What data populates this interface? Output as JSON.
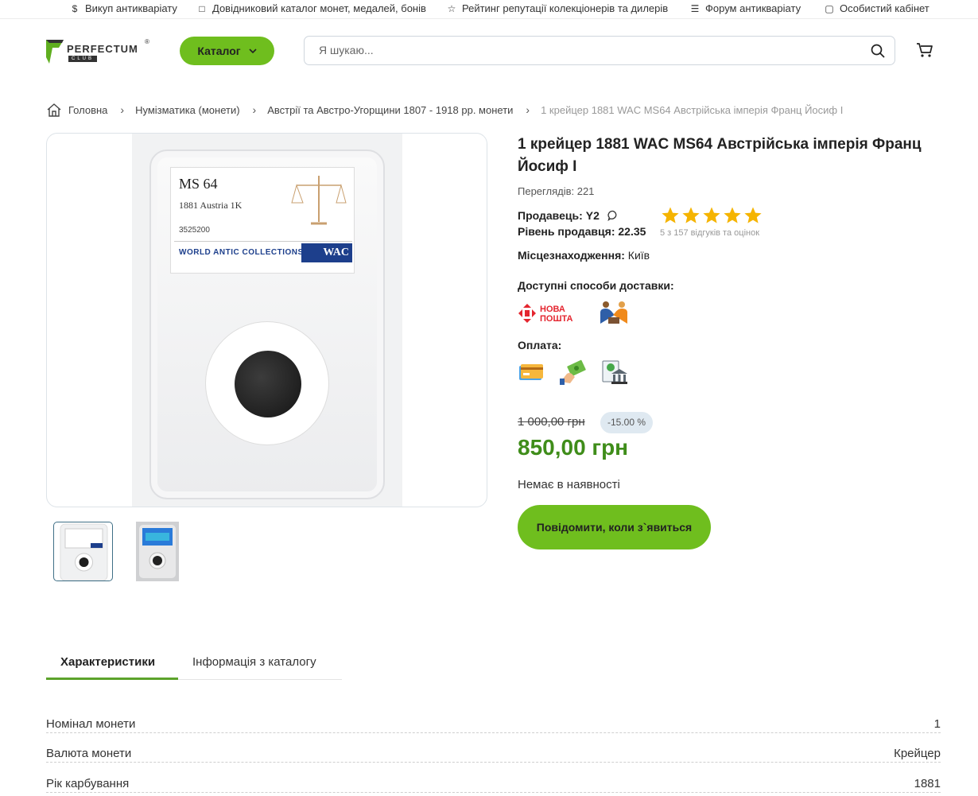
{
  "topbar": {
    "links": [
      {
        "icon": "dollar-icon",
        "glyph": "$",
        "label": "Викуп антикваріату"
      },
      {
        "icon": "book-icon",
        "glyph": "□",
        "label": "Довідниковий каталог монет, медалей, бонів"
      },
      {
        "icon": "star-outline-icon",
        "glyph": "☆",
        "label": "Рейтинг репутації колекціонерів та дилерів"
      },
      {
        "icon": "forum-icon",
        "glyph": "☰",
        "label": "Форум антикваріату"
      },
      {
        "icon": "account-icon",
        "glyph": "▢",
        "label": "Особистий кабінет"
      }
    ]
  },
  "header": {
    "logo_text": "PERFECTUM",
    "logo_sub": "CLUB",
    "logo_reg": "®",
    "catalog_label": "Каталог",
    "search_placeholder": "Я шукаю..."
  },
  "breadcrumb": {
    "items": [
      "Головна",
      "Нумізматика (монети)",
      "Австрії та Австро-Угорщини 1807 - 1918 рр. монети"
    ],
    "current": "1 крейцер 1881 WAC MS64 Австрійська імперія Франц Йосиф I"
  },
  "slab": {
    "grade": "MS 64",
    "desc": "1881 Austria 1K",
    "number": "3525200",
    "company": "WORLD ANTIC COLLECTIONS",
    "brand": "WAC"
  },
  "product": {
    "title": "1 крейцер 1881 WAC MS64 Австрійська імперія Франц Йосиф I",
    "views": "Переглядів: 221",
    "seller_label": "Продавець:",
    "seller_name": "Y2",
    "level": "Рівень продавця: 22.35",
    "rating": 5,
    "reviews": "5 з 157 відгуків та оцінок",
    "location_label": "Місцезнаходження:",
    "location": "Київ",
    "delivery_label": "Доступні способи доставки:",
    "delivery_np_1": "НОВА",
    "delivery_np_2": "ПОШТА",
    "payment_label": "Оплата:",
    "old_price": "1 000,00 грн",
    "discount": "-15.00 %",
    "price": "850,00 грн",
    "stock": "Немає в наявності",
    "notify_label": "Повідомити, коли з`явиться"
  },
  "tabs": [
    "Характеристики",
    "Інформація з каталогу"
  ],
  "specs": [
    {
      "key": "Номінал монети",
      "value": "1"
    },
    {
      "key": "Валюта монети",
      "value": "Крейцер"
    },
    {
      "key": "Рік карбування",
      "value": "1881"
    }
  ],
  "colors": {
    "accent": "#6fbe1e",
    "price": "#3f8d1a",
    "star": "#f5b400"
  }
}
